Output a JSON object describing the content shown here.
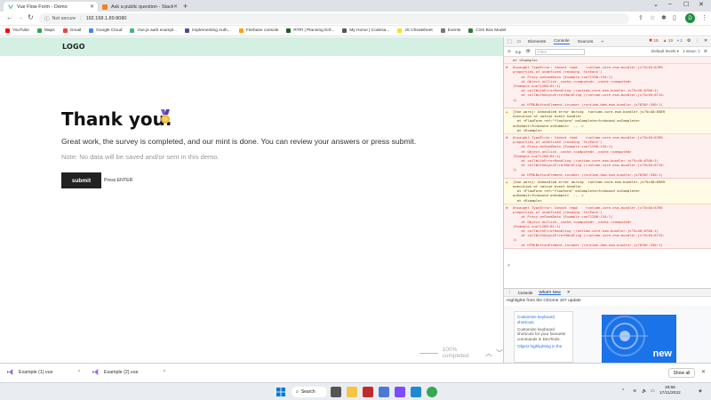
{
  "browser": {
    "tabs": [
      {
        "title": "Vue Flow Form - Demo",
        "active": true
      },
      {
        "title": "Ask a public question - Stack Ov",
        "active": false
      }
    ],
    "address": {
      "security": "Not secure",
      "url": "192.168.1.89:8080"
    },
    "profile_initial": "D",
    "bookmarks": [
      {
        "label": "YouTube",
        "color": "#ff0000"
      },
      {
        "label": "Maps",
        "color": "#34a853"
      },
      {
        "label": "Gmail",
        "color": "#ea4335"
      },
      {
        "label": "Google Cloud",
        "color": "#4285f4"
      },
      {
        "label": "Vue.js auth exampl...",
        "color": "#42b883"
      },
      {
        "label": "Implementing Auth...",
        "color": "#4a4a9a"
      },
      {
        "label": "Firebase console",
        "color": "#ffa000"
      },
      {
        "label": "RTPI | Planning Enf...",
        "color": "#1b5e20"
      },
      {
        "label": "My Home | Codesa...",
        "color": "#555555"
      },
      {
        "label": "JS Cheatsheet",
        "color": "#f7df1e"
      },
      {
        "label": "Events",
        "color": "#777777"
      },
      {
        "label": "CSS Box Model",
        "color": "#2e7d32"
      }
    ]
  },
  "page": {
    "logo": "LOGO",
    "headline": "Thank you.",
    "message": "Great work, the survey is completed, and our mint is done. You can review your answers or press submit.",
    "note": "Note: No data will be saved and/or sent in this demo.",
    "submit_label": "submit",
    "enter_hint": "Press ENTER",
    "progress_label": "100% completed",
    "progress": 1.0,
    "header_color": "#d3f0e2"
  },
  "devtools": {
    "tabs": [
      "Elements",
      "Console",
      "Sources",
      "»"
    ],
    "active_tab": "Console",
    "errors_count": "15",
    "warnings_count": "15",
    "info_count": "1",
    "filter_context": "top",
    "filter_placeholder": "Filter",
    "levels_label": "Default levels ▾",
    "issues_label": "1 Issue:",
    "issues_count": "1",
    "console_lines": [
      {
        "type": "tail",
        "lines": [
          "at <Example>"
        ]
      },
      {
        "type": "error",
        "lines": [
          "Uncaught TypeError: Cannot read    runtime-core.esm-bundler.js?5c40:6769",
          "properties of undefined (reading 'forEach')",
          "    at Proxy.onSendData (Example.vue?1280:134:1)",
          "    at Object.onClick._cache.<computed>._cache.<computed>",
          "(Example.vue?1280:61:1)",
          "    at callWithErrorHandling (runtime-core.esm-bundler.js?5c40:6706:1)",
          "    at callWithAsyncErrorHandling (runtime-core.esm-bundler.js?5c40:6715:",
          "1)",
          "    at HTMLButtonElement.invoker (runtime-dom.esm-bundler.js?830f:350:1)"
        ]
      },
      {
        "type": "warn",
        "lines": [
          "[Vue warn]: Unhandled error during  runtime-core.esm-bundler.js?5c40:6589",
          "execution of native event handler",
          "  at <FlowForm ref=\"flowform\" onComplete=fn<bound onComplete>",
          "onSubmit=fn<bound onSubmit>  ... >",
          "  at <Example>"
        ]
      },
      {
        "type": "error",
        "lines": [
          "Uncaught TypeError: Cannot read    runtime-core.esm-bundler.js?5c40:6769",
          "properties of undefined (reading 'forEach')",
          "    at Proxy.onSendData (Example.vue?1280:134:1)",
          "    at Object.onClick._cache.<computed>._cache.<computed>",
          "(Example.vue?1280:61:1)",
          "    at callWithErrorHandling (runtime-core.esm-bundler.js?5c40:6706:1)",
          "    at callWithAsyncErrorHandling (runtime-core.esm-bundler.js?5c40:6715:",
          "1)",
          "    at HTMLButtonElement.invoker (runtime-dom.esm-bundler.js?830f:350:1)"
        ]
      },
      {
        "type": "warn",
        "lines": [
          "[Vue warn]: Unhandled error during  runtime-core.esm-bundler.js?5c40:6589",
          "execution of native event handler",
          "  at <FlowForm ref=\"flowform\" onComplete=fn<bound onComplete>",
          "onSubmit=fn<bound onSubmit>  ... >",
          "  at <Example>"
        ]
      },
      {
        "type": "error",
        "lines": [
          "Uncaught TypeError: Cannot read    runtime-core.esm-bundler.js?5c40:6769",
          "properties of undefined (reading 'forEach')",
          "    at Proxy.onSendData (Example.vue?1280:134:1)",
          "    at Object.onClick._cache.<computed>._cache.<computed>",
          "(Example.vue?1280:61:1)",
          "    at callWithErrorHandling (runtime-core.esm-bundler.js?5c40:6706:1)",
          "    at callWithAsyncErrorHandling (runtime-core.esm-bundler.js?5c40:6715:",
          "1)",
          "    at HTMLButtonElement.invoker (runtime-dom.esm-bundler.js?830f:350:1)"
        ]
      }
    ],
    "prompt": ">",
    "drawer_tabs": [
      "Console",
      "What's New"
    ],
    "drawer_active": "What's New",
    "highlights_title": "Highlights from the Chrome 107 update",
    "card_items": [
      {
        "title": "Customize keyboard shortcuts",
        "desc": "Customize keyboard shortcuts for your favourite commands in DevTools."
      },
      {
        "title": "Object highlighting in the",
        "desc": ""
      }
    ],
    "banner_text": "new"
  },
  "downloads": {
    "items": [
      "Example (1).vue",
      "Example (2).vue"
    ],
    "show_all": "Show all"
  },
  "taskbar": {
    "search_label": "Search",
    "time": "19:56",
    "date": "17/11/2022"
  }
}
